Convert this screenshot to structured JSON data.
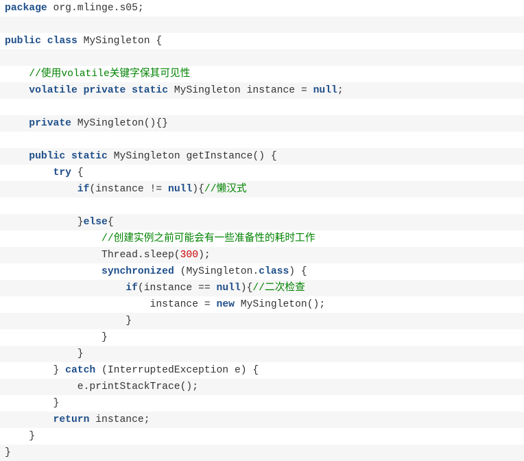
{
  "colors": {
    "keyword": "#1f4f8a",
    "comment": "#008200",
    "number": "#c80000",
    "text": "#333333",
    "stripe": "#f6f6f6"
  },
  "code_lines": [
    [
      [
        "kw",
        "package"
      ],
      [
        "tx",
        " org.mlinge.s05;"
      ]
    ],
    [],
    [
      [
        "kw",
        "public"
      ],
      [
        "tx",
        " "
      ],
      [
        "kw",
        "class"
      ],
      [
        "tx",
        " MySingleton {"
      ]
    ],
    [],
    [
      [
        "tx",
        "    "
      ],
      [
        "cm",
        "//使用volatile关键字保其可见性"
      ]
    ],
    [
      [
        "tx",
        "    "
      ],
      [
        "kw",
        "volatile"
      ],
      [
        "tx",
        " "
      ],
      [
        "kw",
        "private"
      ],
      [
        "tx",
        " "
      ],
      [
        "kw",
        "static"
      ],
      [
        "tx",
        " MySingleton instance = "
      ],
      [
        "kw",
        "null"
      ],
      [
        "tx",
        ";"
      ]
    ],
    [],
    [
      [
        "tx",
        "    "
      ],
      [
        "kw",
        "private"
      ],
      [
        "tx",
        " MySingleton(){}"
      ]
    ],
    [],
    [
      [
        "tx",
        "    "
      ],
      [
        "kw",
        "public"
      ],
      [
        "tx",
        " "
      ],
      [
        "kw",
        "static"
      ],
      [
        "tx",
        " MySingleton getInstance() {"
      ]
    ],
    [
      [
        "tx",
        "        "
      ],
      [
        "kw",
        "try"
      ],
      [
        "tx",
        " {"
      ]
    ],
    [
      [
        "tx",
        "            "
      ],
      [
        "kw",
        "if"
      ],
      [
        "tx",
        "(instance != "
      ],
      [
        "kw",
        "null"
      ],
      [
        "tx",
        "){"
      ],
      [
        "cm",
        "//懒汉式"
      ]
    ],
    [],
    [
      [
        "tx",
        "            }"
      ],
      [
        "kw",
        "else"
      ],
      [
        "tx",
        "{"
      ]
    ],
    [
      [
        "tx",
        "                "
      ],
      [
        "cm",
        "//创建实例之前可能会有一些准备性的耗时工作"
      ]
    ],
    [
      [
        "tx",
        "                Thread.sleep("
      ],
      [
        "num",
        "300"
      ],
      [
        "tx",
        ");"
      ]
    ],
    [
      [
        "tx",
        "                "
      ],
      [
        "kw",
        "synchronized"
      ],
      [
        "tx",
        " (MySingleton."
      ],
      [
        "kw",
        "class"
      ],
      [
        "tx",
        ") {"
      ]
    ],
    [
      [
        "tx",
        "                    "
      ],
      [
        "kw",
        "if"
      ],
      [
        "tx",
        "(instance == "
      ],
      [
        "kw",
        "null"
      ],
      [
        "tx",
        "){"
      ],
      [
        "cm",
        "//二次检查"
      ]
    ],
    [
      [
        "tx",
        "                        instance = "
      ],
      [
        "kw",
        "new"
      ],
      [
        "tx",
        " MySingleton();"
      ]
    ],
    [
      [
        "tx",
        "                    }"
      ]
    ],
    [
      [
        "tx",
        "                }"
      ]
    ],
    [
      [
        "tx",
        "            }"
      ]
    ],
    [
      [
        "tx",
        "        } "
      ],
      [
        "kw",
        "catch"
      ],
      [
        "tx",
        " (InterruptedException e) {"
      ]
    ],
    [
      [
        "tx",
        "            e.printStackTrace();"
      ]
    ],
    [
      [
        "tx",
        "        }"
      ]
    ],
    [
      [
        "tx",
        "        "
      ],
      [
        "kw",
        "return"
      ],
      [
        "tx",
        " instance;"
      ]
    ],
    [
      [
        "tx",
        "    }"
      ]
    ],
    [
      [
        "tx",
        "}"
      ]
    ]
  ]
}
